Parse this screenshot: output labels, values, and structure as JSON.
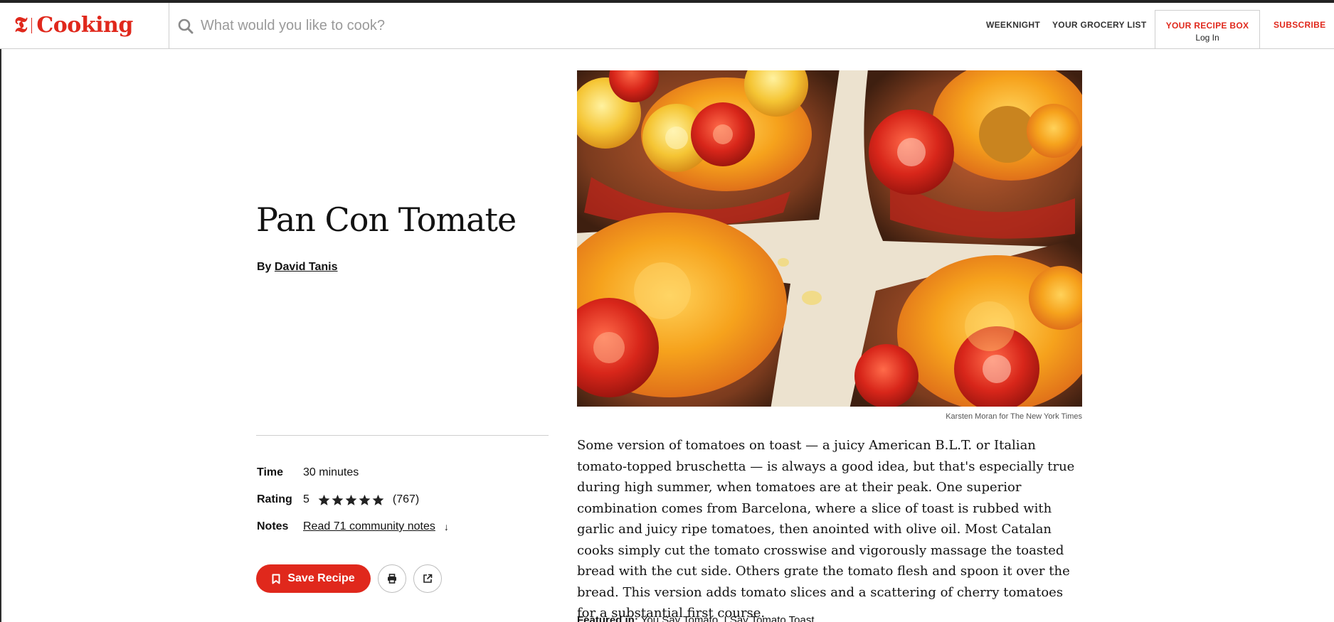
{
  "header": {
    "logo_mark": "𝕿",
    "logo_text": "Cooking",
    "search_placeholder": "What would you like to cook?",
    "nav": {
      "weeknight": "WEEKNIGHT",
      "grocery_list": "YOUR GROCERY LIST",
      "recipe_box": "YOUR RECIPE BOX",
      "login": "Log In",
      "subscribe": "SUBSCRIBE"
    }
  },
  "recipe": {
    "title": "Pan Con Tomate",
    "by_label": "By",
    "author": "David Tanis",
    "meta": {
      "time_label": "Time",
      "time_value": "30 minutes",
      "rating_label": "Rating",
      "rating_value": "5",
      "rating_stars": 5,
      "rating_count": "(767)",
      "notes_label": "Notes",
      "notes_link": "Read 71 community notes",
      "notes_arrow": "↓"
    },
    "save_label": "Save Recipe",
    "photo_credit": "Karsten Moran for The New York Times",
    "description": "Some version of tomatoes on toast — a juicy American B.L.T. or Italian tomato-topped bruschetta — is always a good idea, but that's especially true during high summer, when tomatoes are at their peak. One superior combination comes from Barcelona, where a slice of toast is rubbed with garlic and juicy ripe tomatoes, then anointed with olive oil. Most Catalan cooks simply cut the tomato crosswise and vigorously massage the toasted bread with the cut side. Others grate the tomato flesh and spoon it over the bread. This version adds tomato slices and a scattering of cherry tomatoes for a substantial first course.",
    "featured_label": "Featured in:",
    "featured_links": "You Say Tomato, I Say Tomato Toast"
  },
  "colors": {
    "brand": "#e0281c",
    "text": "#121212",
    "border": "#cfcfcf"
  }
}
